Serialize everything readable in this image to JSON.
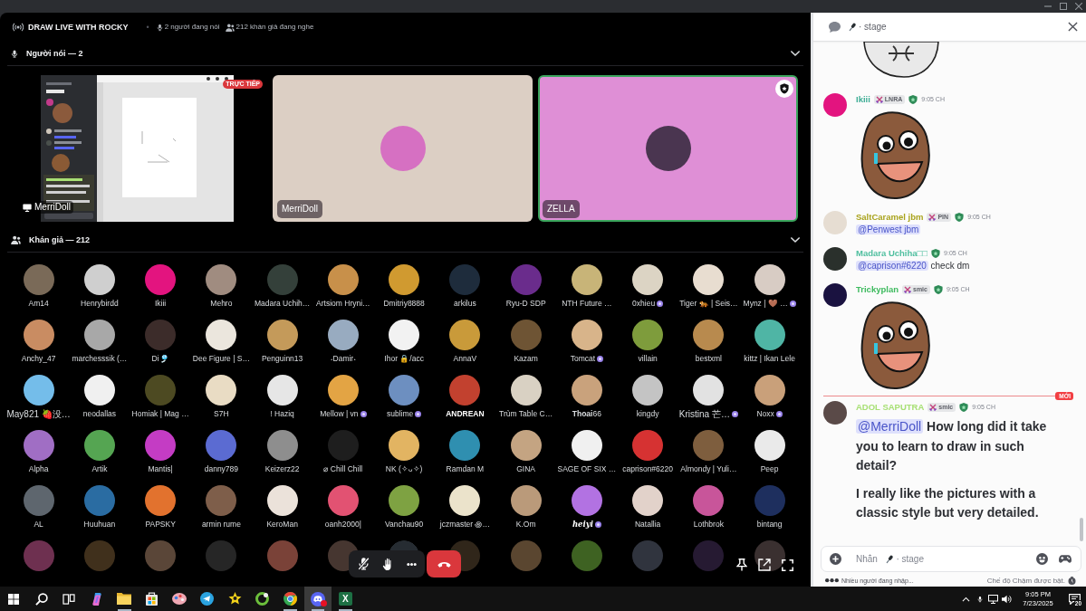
{
  "stage": {
    "title": "DRAW LIVE WITH ROCKY",
    "separator": "•",
    "speaking_count": "2 người đang nói",
    "listener_count": "212 khán giả đang nghe"
  },
  "speakers": {
    "title": "Người nói — 2",
    "expanded": true,
    "tiles": [
      {
        "kind": "screen_share",
        "name": "MerriDoll",
        "live_badge": "TRỰC TIẾP",
        "speaking": false,
        "moderator": false
      },
      {
        "kind": "avatar",
        "name": "MerriDoll",
        "color": "#dccfc4",
        "avatar": {
          "color": "#d670c2"
        },
        "speaking": false,
        "moderator": false
      },
      {
        "kind": "avatar",
        "name": "ZELLA",
        "color": "#df8fd6",
        "avatar": {
          "color": "#4a3550"
        },
        "speaking": true,
        "moderator": true
      }
    ]
  },
  "audience": {
    "title": "Khán giả — 212",
    "expanded": true,
    "members": [
      {
        "name": "Am14",
        "color": "#7a6a58",
        "badge": false,
        "kind": "plain"
      },
      {
        "name": "Henrybirdd",
        "color": "#cfcfcf",
        "badge": false,
        "kind": "plain"
      },
      {
        "name": "Ikiii",
        "color": "#e3147f",
        "badge": false,
        "kind": "plain"
      },
      {
        "name": "Mehro",
        "color": "#a08c80",
        "badge": false,
        "kind": "plain"
      },
      {
        "name": "Madara Uchih…",
        "color": "#34403a",
        "badge": false,
        "kind": "plain"
      },
      {
        "name": "Artsiom Hryni…",
        "color": "#c8904a",
        "badge": false,
        "kind": "plain"
      },
      {
        "name": "Dmitriy8888",
        "color": "#d09a30",
        "badge": false,
        "kind": "plain"
      },
      {
        "name": "arkilus",
        "color": "#1e2c3c",
        "badge": false,
        "kind": "plain"
      },
      {
        "name": "Ryu-D SDP",
        "color": "#6a2c8c",
        "badge": false,
        "kind": "plain"
      },
      {
        "name": "NTH Future …",
        "color": "#c8b478",
        "badge": false,
        "kind": "plain"
      },
      {
        "name": "0xhieu",
        "color": "#dcd4c4",
        "badge": true,
        "kind": "plain"
      },
      {
        "name": "Tiger 🐅 | Seis…",
        "color": "#e8ddd0",
        "badge": false,
        "kind": "plain"
      },
      {
        "name": "Mynz | 🤎 …",
        "color": "#d8ccc4",
        "badge": true,
        "kind": "plain"
      },
      {
        "name": "Anchy_47",
        "color": "#c98c62",
        "badge": false,
        "kind": "plain"
      },
      {
        "name": "marchesssik (…",
        "color": "#a8a8a8",
        "badge": false,
        "kind": "plain"
      },
      {
        "name": "Di🎐",
        "color": "#3c2c2a",
        "badge": false,
        "kind": "plain"
      },
      {
        "name": "Dee Figure | S…",
        "color": "#ebe6dd",
        "badge": false,
        "kind": "plain"
      },
      {
        "name": "Penguinn13",
        "color": "#c49a5a",
        "badge": false,
        "kind": "plain"
      },
      {
        "name": "˖Damir˖",
        "color": "#98abc0",
        "badge": false,
        "kind": "plain"
      },
      {
        "name": "Ihor 🔒/acc",
        "color": "#f2f2f2",
        "badge": false,
        "kind": "plain"
      },
      {
        "name": "AnnaV",
        "color": "#c99a3a",
        "badge": false,
        "kind": "plain"
      },
      {
        "name": "Kazam",
        "color": "#6e5434",
        "badge": false,
        "kind": "plain"
      },
      {
        "name": "Tomcat",
        "color": "#d8b48a",
        "badge": true,
        "kind": "plain"
      },
      {
        "name": "villain",
        "color": "#7e9c3c",
        "badge": false,
        "kind": "plain"
      },
      {
        "name": "bestxml",
        "color": "#b88a4e",
        "badge": false,
        "kind": "plain"
      },
      {
        "name": "kittz | Ikan Lele",
        "color": "#4fb5a5",
        "badge": false,
        "kind": "plain"
      },
      {
        "name": "May821 🍓没…",
        "color": "#74bdea",
        "badge": false,
        "kind": "plain"
      },
      {
        "name": "neodallas",
        "color": "#f0f0f0",
        "badge": false,
        "kind": "plain"
      },
      {
        "name": "Homiak | Mag …",
        "color": "#4d4a22",
        "badge": false,
        "kind": "plain"
      },
      {
        "name": "S7H",
        "color": "#e9dcc4",
        "badge": false,
        "kind": "plain"
      },
      {
        "name": "! Haziq",
        "color": "#e6e6e6",
        "badge": false,
        "kind": "plain"
      },
      {
        "name": "Mellow | vn",
        "color": "#e3a444",
        "badge": true,
        "kind": "plain"
      },
      {
        "name": "sublime",
        "color": "#6d8fc0",
        "badge": true,
        "kind": "plain"
      },
      {
        "name": "ANDREAN",
        "color": "#c2412f",
        "badge": false,
        "kind": "bold"
      },
      {
        "name": "Trùm Table C…",
        "color": "#d9d1c3",
        "badge": false,
        "kind": "plain"
      },
      {
        "name": "**Thoai**66",
        "color": "#c9a27c",
        "badge": false,
        "kind": "plain"
      },
      {
        "name": "kingdy",
        "color": "#c4c4c4",
        "badge": false,
        "kind": "plain"
      },
      {
        "name": "Kristina 芒…",
        "color": "#e2e2e2",
        "badge": true,
        "kind": "plain"
      },
      {
        "name": "Noxx",
        "color": "#c9a07a",
        "badge": true,
        "kind": "plain"
      },
      {
        "name": "Alpha",
        "color": "#a06ec4",
        "badge": false,
        "kind": "plain"
      },
      {
        "name": "Artik",
        "color": "#55a552",
        "badge": false,
        "kind": "plain"
      },
      {
        "name": "Mantis|",
        "color": "#c43cc4",
        "badge": false,
        "kind": "plain"
      },
      {
        "name": "danny789",
        "color": "#5b6bd2",
        "badge": false,
        "kind": "plain"
      },
      {
        "name": "Keizerz22",
        "color": "#8e8e8e",
        "badge": false,
        "kind": "plain"
      },
      {
        "name": "⌀ Chill Chill",
        "color": "#1e1e1e",
        "badge": false,
        "kind": "plain"
      },
      {
        "name": "NK (✧ᴗ✧)",
        "color": "#e2b462",
        "badge": false,
        "kind": "plain"
      },
      {
        "name": "Ramdan M",
        "color": "#2f8fb0",
        "badge": false,
        "kind": "plain"
      },
      {
        "name": "GINA",
        "color": "#c4a482",
        "badge": false,
        "kind": "plain"
      },
      {
        "name": "SAGE OF SIX …",
        "color": "#f0f0f0",
        "badge": false,
        "kind": "plain"
      },
      {
        "name": "caprison#6220",
        "color": "#d63232",
        "badge": false,
        "kind": "plain"
      },
      {
        "name": "Almondy | Yuli…",
        "color": "#7e5e3e",
        "badge": false,
        "kind": "plain"
      },
      {
        "name": "Peep",
        "color": "#eaeaea",
        "badge": false,
        "kind": "plain"
      },
      {
        "name": "AL",
        "color": "#5e666e",
        "badge": false,
        "kind": "plain"
      },
      {
        "name": "Huuhuan",
        "color": "#2a6ca2",
        "badge": false,
        "kind": "plain"
      },
      {
        "name": "PAPSKY",
        "color": "#e2722e",
        "badge": false,
        "kind": "plain"
      },
      {
        "name": "armin rume",
        "color": "#7e5e4a",
        "badge": false,
        "kind": "plain"
      },
      {
        "name": "KeroMan",
        "color": "#ebe2da",
        "badge": false,
        "kind": "plain"
      },
      {
        "name": "oanh2000|",
        "color": "#e25272",
        "badge": false,
        "kind": "plain"
      },
      {
        "name": "Vanchau90",
        "color": "#7ea242",
        "badge": false,
        "kind": "plain"
      },
      {
        "name": "jczmaster ꩜…",
        "color": "#ebe3cb",
        "badge": false,
        "kind": "plain"
      },
      {
        "name": "K.Om",
        "color": "#ba9a7a",
        "badge": false,
        "kind": "plain"
      },
      {
        "name": "heiyi",
        "color": "#b272e2",
        "badge": true,
        "kind": "script"
      },
      {
        "name": "Natallia",
        "color": "#e2d2ca",
        "badge": false,
        "kind": "plain"
      },
      {
        "name": "Lothbrok",
        "color": "#c8559a",
        "badge": false,
        "kind": "plain"
      },
      {
        "name": "bintang",
        "color": "#1e2f5e",
        "badge": false,
        "kind": "plain"
      },
      {
        "color": "#6e3050",
        "badge": false
      },
      {
        "color": "#40301c",
        "badge": false
      },
      {
        "color": "#5a4638",
        "badge": false
      },
      {
        "color": "#262626",
        "badge": false
      },
      {
        "color": "#7a4238",
        "badge": false
      },
      {
        "color": "#463630",
        "badge": false
      },
      {
        "color": "#262c32",
        "badge": false
      },
      {
        "color": "#30261a",
        "badge": false
      },
      {
        "color": "#5a4630",
        "badge": false
      },
      {
        "color": "#3e6222",
        "badge": false
      },
      {
        "color": "#30343e",
        "badge": false
      },
      {
        "color": "#261a32",
        "badge": false
      },
      {
        "color": "#3a3030",
        "badge": false
      }
    ]
  },
  "call_controls": {
    "mic_muted": true
  },
  "chat": {
    "channel": "· stage",
    "items": [
      {
        "kind": "sticker"
      },
      {
        "kind": "message",
        "author": "Ikiii",
        "color": "#3fae96",
        "avatar": {
          "color": "#e3147f"
        },
        "tag": "LNRA",
        "badge": true,
        "time": "9:05 CH",
        "sticker": true
      },
      {
        "kind": "message",
        "author": "SaltCaramel jbm",
        "color": "#a9a31c",
        "avatar": {
          "color": "#e6ddd2"
        },
        "tag": "PIN",
        "badge": true,
        "time": "9:05 CH",
        "sticker": false,
        "body": [
          {
            "kind": "text",
            "parts": [
              {
                "kind": "mention",
                "text": "@Penwest jbm"
              }
            ]
          }
        ]
      },
      {
        "kind": "message",
        "author": "Madara Uchiha□□",
        "color": "#4fbf9f",
        "avatar": {
          "color": "#2a302c"
        },
        "badge": true,
        "time": "9:05 CH",
        "sticker": false,
        "body": [
          {
            "kind": "text",
            "parts": [
              {
                "kind": "mention",
                "text": "@caprison#6220"
              },
              {
                "kind": "plain",
                "text": " check dm"
              }
            ]
          }
        ]
      },
      {
        "kind": "message",
        "author": "Trickyplan",
        "color": "#3dba5e",
        "avatar": {
          "color": "#1a1240"
        },
        "tag": "smic",
        "badge": true,
        "time": "9:05 CH",
        "sticker": true
      },
      {
        "kind": "divider",
        "label": "MỚI"
      },
      {
        "kind": "message",
        "author": "ADOL SAPUTRA",
        "color": "#a8e075",
        "avatar": {
          "color": "#5a4a48"
        },
        "tag": "smic",
        "badge": true,
        "time": "9:05 CH",
        "sticker": false,
        "body": [
          {
            "kind": "heading",
            "parts": [
              {
                "kind": "mention",
                "text": "@MerriDoll"
              },
              {
                "kind": "plain",
                "text": " How long did it take you to learn to draw in such detail?"
              }
            ]
          },
          {
            "kind": "heading",
            "parts": [
              {
                "kind": "plain",
                "text": "I really like the pictures with a classic style but very detailed."
              }
            ]
          }
        ]
      }
    ],
    "input": {
      "placeholder": "Nhắn",
      "hint": "· stage"
    },
    "typing": "Nhiều người đang nhập...",
    "slow_mode": "Chế độ Chậm được bật."
  },
  "taskbar": {
    "apps": [
      {
        "kind": "start",
        "running": false,
        "active": false,
        "badge": false
      },
      {
        "kind": "search",
        "running": false,
        "active": false,
        "badge": false
      },
      {
        "kind": "task_view",
        "running": false,
        "active": false,
        "badge": false
      },
      {
        "kind": "assistant",
        "running": false,
        "active": false,
        "badge": false
      },
      {
        "kind": "explorer",
        "running": true,
        "active": false,
        "badge": false
      },
      {
        "kind": "store",
        "running": false,
        "active": false,
        "badge": false
      },
      {
        "kind": "paint",
        "running": false,
        "active": false,
        "badge": false
      },
      {
        "kind": "telegram",
        "running": false,
        "active": false,
        "badge": false
      },
      {
        "kind": "star",
        "running": false,
        "active": false,
        "badge": false
      },
      {
        "kind": "ring",
        "running": false,
        "active": false,
        "badge": false
      },
      {
        "kind": "browser",
        "running": true,
        "active": false,
        "badge": false
      },
      {
        "kind": "chat",
        "running": true,
        "active": true,
        "badge": true
      },
      {
        "kind": "sheet",
        "label": "X",
        "running": true,
        "active": false,
        "badge": false
      }
    ],
    "time": "9:05 PM",
    "date": "7/23/2025",
    "notifications": "20"
  }
}
